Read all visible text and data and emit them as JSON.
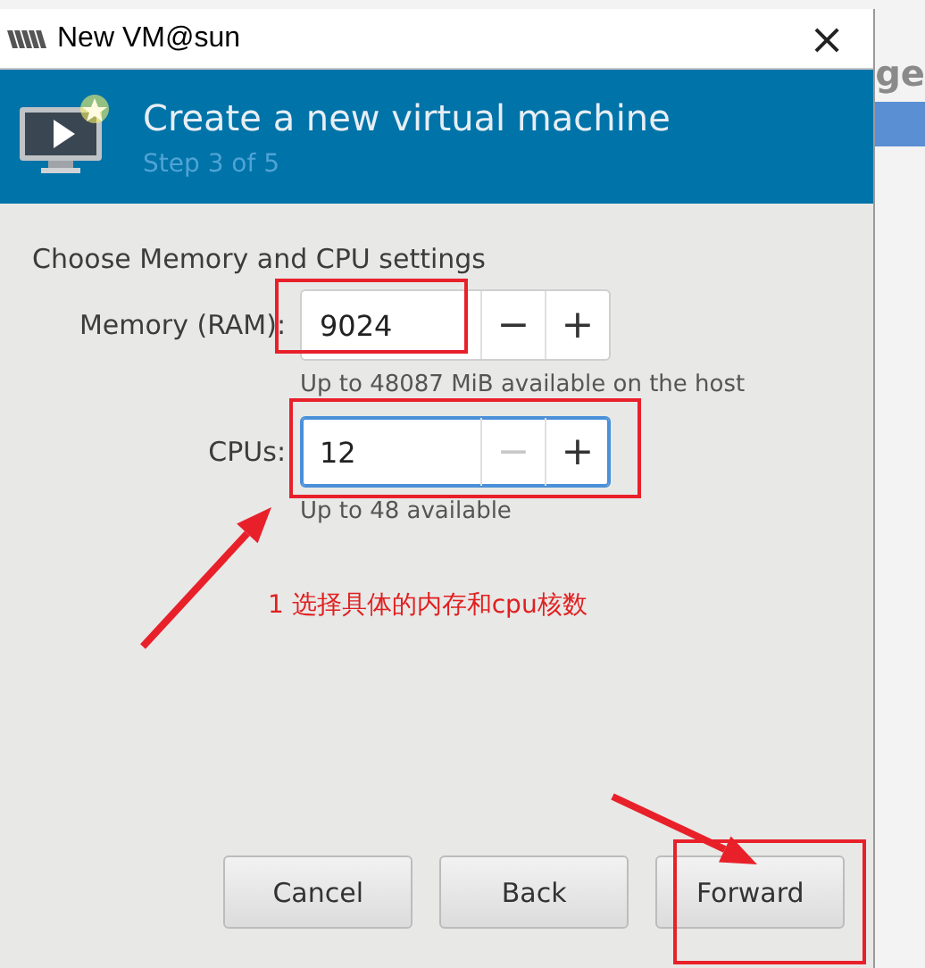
{
  "background": {
    "text": "ge"
  },
  "window": {
    "title": "New VM@sun",
    "close": "×"
  },
  "header": {
    "title": "Create a new virtual machine",
    "step": "Step 3 of 5"
  },
  "section_title": "Choose Memory and CPU settings",
  "fields": [
    {
      "label": "Memory (RAM):",
      "value": "9024",
      "decrement": "−",
      "increment": "+",
      "focused": false,
      "decrement_disabled": false,
      "hint": "Up to 48087 MiB available on the host"
    },
    {
      "label": "CPUs:",
      "value": "12",
      "decrement": "−",
      "increment": "+",
      "focused": true,
      "decrement_disabled": true,
      "hint": "Up to 48 available"
    }
  ],
  "annotation": "1 选择具体的内存和cpu核数",
  "buttons": [
    {
      "label": "Cancel"
    },
    {
      "label": "Back"
    },
    {
      "label": "Forward"
    }
  ]
}
